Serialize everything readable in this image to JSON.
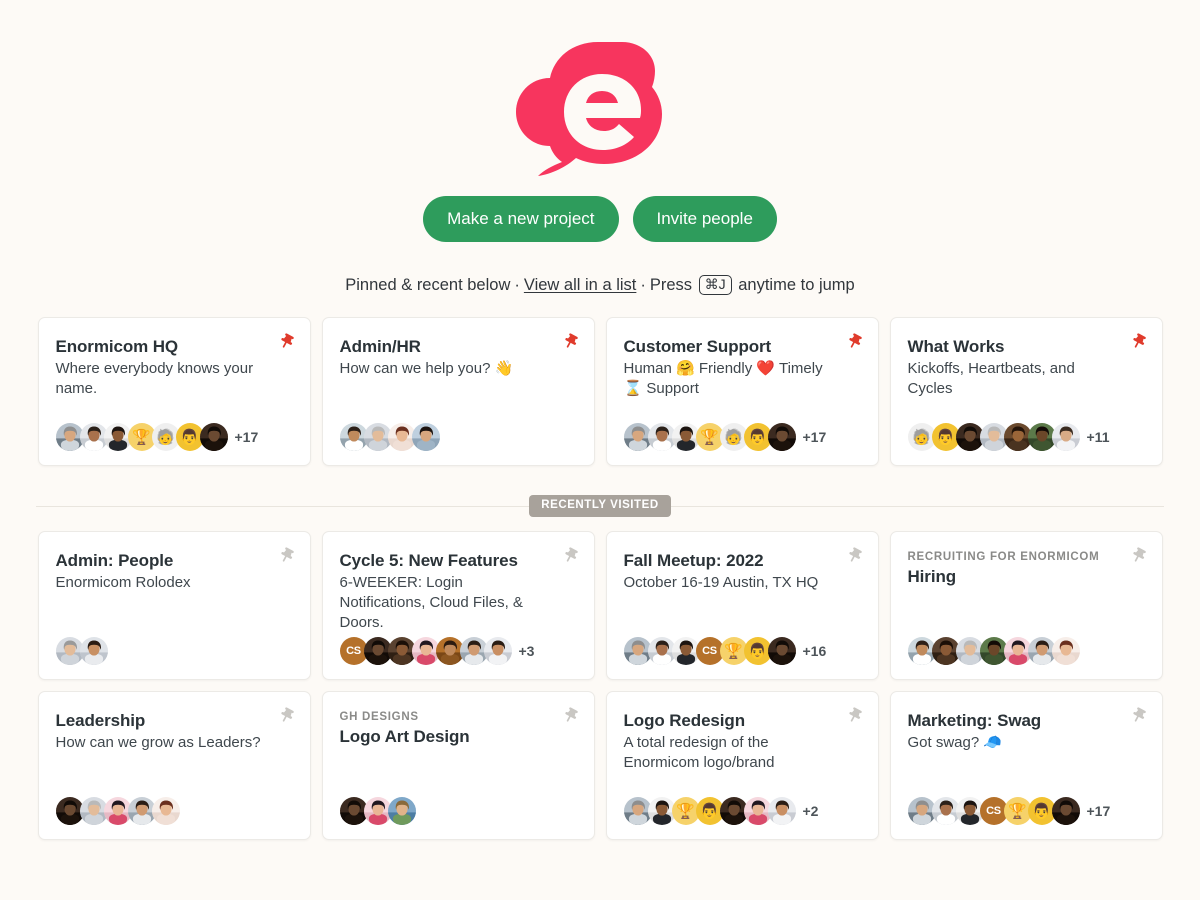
{
  "brand": {
    "logo_name": "basecamp-cloud-e-logo",
    "logo_color": "#f7355e",
    "button_color": "#2e9c5c"
  },
  "actions": {
    "new_project_label": "Make a new project",
    "invite_people_label": "Invite people"
  },
  "jumpline": {
    "prefix": "Pinned & recent below",
    "link_label": "View all in a list",
    "press_label": "Press",
    "shortcut": "⌘J",
    "suffix": "anytime to jump",
    "separator": "·"
  },
  "divider": {
    "label": "RECENTLY VISITED"
  },
  "pinned": [
    {
      "title": "Enormicom HQ",
      "eyebrow": "",
      "desc": "Where everybody knows your name.",
      "pinned": true,
      "more": "+17",
      "avatars": [
        {
          "type": "photo",
          "c1": "#b7c2cc",
          "c2": "#6f7d88",
          "skin": "#d7a77f",
          "hair": "#8e8e8e",
          "shirt": "#cfd6dc"
        },
        {
          "type": "photo",
          "c1": "#e3e6ea",
          "c2": "#c7ccd2",
          "skin": "#a9714c",
          "hair": "#2b2019",
          "shirt": "#ffffff"
        },
        {
          "type": "photo",
          "c1": "#f2f2f2",
          "c2": "#dedede",
          "skin": "#8a5a36",
          "hair": "#1c1410",
          "shirt": "#23262b"
        },
        {
          "type": "emoji",
          "glyph": "🏆",
          "bg": "#f6d26a"
        },
        {
          "type": "emoji",
          "glyph": "🧓",
          "bg": "#efefef"
        },
        {
          "type": "emoji",
          "glyph": "👨",
          "bg": "#f2c230"
        },
        {
          "type": "photo",
          "c1": "#3b2a20",
          "c2": "#120b07",
          "skin": "#6b4a32",
          "hair": "#110b07",
          "shirt": "#1c120b"
        }
      ]
    },
    {
      "title": "Admin/HR",
      "eyebrow": "",
      "desc": "How can we help you? 👋",
      "pinned": true,
      "more": "",
      "avatars": [
        {
          "type": "photo",
          "c1": "#cdd8de",
          "c2": "#94a3ad",
          "skin": "#c08a5c",
          "hair": "#2d2018",
          "shirt": "#ffffff"
        },
        {
          "type": "photo",
          "c1": "#d8dce2",
          "c2": "#b2b9c2",
          "skin": "#e3bc9a",
          "hair": "#b9b9b9",
          "shirt": "#cfd4da"
        },
        {
          "type": "photo",
          "c1": "#f7eee9",
          "c2": "#e9d8cf",
          "skin": "#e8b894",
          "hair": "#6b2f1e",
          "shirt": "#f0dfd6"
        },
        {
          "type": "photo",
          "c1": "#bfd0df",
          "c2": "#8fa5b8",
          "skin": "#d7a77f",
          "hair": "#1d1410",
          "shirt": "#9fb4c6"
        }
      ]
    },
    {
      "title": "Customer Support",
      "eyebrow": "",
      "desc": "Human 🤗 Friendly ❤️ Timely ⌛ Support",
      "pinned": true,
      "more": "+17",
      "avatars": [
        {
          "type": "photo",
          "c1": "#b7c2cc",
          "c2": "#6f7d88",
          "skin": "#d7a77f",
          "hair": "#8e8e8e",
          "shirt": "#cfd6dc"
        },
        {
          "type": "photo",
          "c1": "#e3e6ea",
          "c2": "#c7ccd2",
          "skin": "#a9714c",
          "hair": "#2b2019",
          "shirt": "#ffffff"
        },
        {
          "type": "photo",
          "c1": "#f2f2f2",
          "c2": "#dedede",
          "skin": "#8a5a36",
          "hair": "#1c1410",
          "shirt": "#23262b"
        },
        {
          "type": "emoji",
          "glyph": "🏆",
          "bg": "#f6d26a"
        },
        {
          "type": "emoji",
          "glyph": "🧓",
          "bg": "#efefef"
        },
        {
          "type": "emoji",
          "glyph": "👨",
          "bg": "#f2c230"
        },
        {
          "type": "photo",
          "c1": "#3b2a20",
          "c2": "#120b07",
          "skin": "#6b4a32",
          "hair": "#110b07",
          "shirt": "#1c120b"
        }
      ]
    },
    {
      "title": "What Works",
      "eyebrow": "",
      "desc": "Kickoffs, Heartbeats, and Cycles",
      "pinned": true,
      "more": "+11",
      "avatars": [
        {
          "type": "emoji",
          "glyph": "🧓",
          "bg": "#efefef"
        },
        {
          "type": "emoji",
          "glyph": "👨",
          "bg": "#f2c230"
        },
        {
          "type": "photo",
          "c1": "#3b2a20",
          "c2": "#120b07",
          "skin": "#6b4a32",
          "hair": "#110b07",
          "shirt": "#1c120b"
        },
        {
          "type": "photo",
          "c1": "#d8dce2",
          "c2": "#b2b9c2",
          "skin": "#e3bc9a",
          "hair": "#b9b9b9",
          "shirt": "#cfd4da"
        },
        {
          "type": "photo",
          "c1": "#6b4a2e",
          "c2": "#3a2616",
          "skin": "#9a6538",
          "hair": "#241409",
          "shirt": "#4a3320"
        },
        {
          "type": "photo",
          "c1": "#5c7a4a",
          "c2": "#33482a",
          "skin": "#6b4729",
          "hair": "#120b06",
          "shirt": "#3f5631"
        },
        {
          "type": "photo",
          "c1": "#e8eaee",
          "c2": "#c9ccd3",
          "skin": "#d8ab86",
          "hair": "#3a2b20",
          "shirt": "#f2f3f5"
        }
      ]
    }
  ],
  "recent_row1": [
    {
      "title": "Admin: People",
      "eyebrow": "",
      "desc": "Enormicom Rolodex",
      "pinned": false,
      "more": "",
      "avatars": [
        {
          "type": "photo",
          "c1": "#d8dce2",
          "c2": "#b2b9c2",
          "skin": "#e3bc9a",
          "hair": "#9a9a9a",
          "shirt": "#cfd4da"
        },
        {
          "type": "photo",
          "c1": "#dfe3e8",
          "c2": "#bfc5cd",
          "skin": "#c89063",
          "hair": "#2a1c13",
          "shirt": "#e9ebee"
        }
      ]
    },
    {
      "title": "Cycle 5: New Features",
      "eyebrow": "",
      "desc": "6-WEEKER: Login Notifications, Cloud Files, & Doors.",
      "pinned": false,
      "more": "+3",
      "avatars": [
        {
          "type": "initials",
          "text": "CS",
          "bg": "#b5712a"
        },
        {
          "type": "photo",
          "c1": "#3b2a20",
          "c2": "#120b07",
          "skin": "#6b4a32",
          "hair": "#110b07",
          "shirt": "#1c120b"
        },
        {
          "type": "photo",
          "c1": "#5a4230",
          "c2": "#2e1f13",
          "skin": "#8a5a36",
          "hair": "#1b0f07",
          "shirt": "#4d3522"
        },
        {
          "type": "photo",
          "c1": "#f6d7de",
          "c2": "#e6b9c4",
          "skin": "#e9b695",
          "hair": "#221820",
          "shirt": "#d94a6a"
        },
        {
          "type": "photo",
          "c1": "#b5712a",
          "c2": "#7a4716",
          "skin": "#c08a5c",
          "hair": "#2d1c10",
          "shirt": "#8c5620"
        },
        {
          "type": "photo",
          "c1": "#c8cfd6",
          "c2": "#9aa6b0",
          "skin": "#d09b72",
          "hair": "#2a1d15",
          "shirt": "#e6e9ec"
        },
        {
          "type": "photo",
          "c1": "#e8eaee",
          "c2": "#c9ccd3",
          "skin": "#c98f63",
          "hair": "#2b1d14",
          "shirt": "#f2f3f5"
        }
      ]
    },
    {
      "title": "Fall Meetup: 2022",
      "eyebrow": "",
      "desc": "October 16-19 Austin, TX HQ",
      "pinned": false,
      "more": "+16",
      "avatars": [
        {
          "type": "photo",
          "c1": "#b7c2cc",
          "c2": "#6f7d88",
          "skin": "#d7a77f",
          "hair": "#8e8e8e",
          "shirt": "#cfd6dc"
        },
        {
          "type": "photo",
          "c1": "#e3e6ea",
          "c2": "#c7ccd2",
          "skin": "#a9714c",
          "hair": "#2b2019",
          "shirt": "#ffffff"
        },
        {
          "type": "photo",
          "c1": "#f2f2f2",
          "c2": "#dedede",
          "skin": "#8a5a36",
          "hair": "#1c1410",
          "shirt": "#23262b"
        },
        {
          "type": "initials",
          "text": "CS",
          "bg": "#b5712a"
        },
        {
          "type": "emoji",
          "glyph": "🏆",
          "bg": "#f6d26a"
        },
        {
          "type": "emoji",
          "glyph": "👨",
          "bg": "#f2c230"
        },
        {
          "type": "photo",
          "c1": "#3b2a20",
          "c2": "#120b07",
          "skin": "#6b4a32",
          "hair": "#110b07",
          "shirt": "#1c120b"
        }
      ]
    },
    {
      "title": "Hiring",
      "eyebrow": "RECRUITING FOR ENORMICOM",
      "desc": "",
      "pinned": false,
      "more": "",
      "avatars": [
        {
          "type": "photo",
          "c1": "#cdd8de",
          "c2": "#94a3ad",
          "skin": "#c08a5c",
          "hair": "#2d2018",
          "shirt": "#ffffff"
        },
        {
          "type": "photo",
          "c1": "#5a4230",
          "c2": "#2e1f13",
          "skin": "#8a5a36",
          "hair": "#1b0f07",
          "shirt": "#4d3522"
        },
        {
          "type": "photo",
          "c1": "#d8dce2",
          "c2": "#b2b9c2",
          "skin": "#e3bc9a",
          "hair": "#b9b9b9",
          "shirt": "#cfd4da"
        },
        {
          "type": "photo",
          "c1": "#5c7a4a",
          "c2": "#33482a",
          "skin": "#6b4729",
          "hair": "#120b06",
          "shirt": "#3f5631"
        },
        {
          "type": "photo",
          "c1": "#f6d7de",
          "c2": "#e6b9c4",
          "skin": "#e9b695",
          "hair": "#221820",
          "shirt": "#d94a6a"
        },
        {
          "type": "photo",
          "c1": "#c8cfd6",
          "c2": "#9aa6b0",
          "skin": "#d09b72",
          "hair": "#2a1d15",
          "shirt": "#e6e9ec"
        },
        {
          "type": "photo",
          "c1": "#f7eee9",
          "c2": "#e9d8cf",
          "skin": "#e8b894",
          "hair": "#6b2f1e",
          "shirt": "#f0dfd6"
        }
      ]
    }
  ],
  "recent_row2": [
    {
      "title": "Leadership",
      "eyebrow": "",
      "desc": "How can we grow as Leaders?",
      "pinned": false,
      "more": "",
      "avatars": [
        {
          "type": "photo",
          "c1": "#3b2a20",
          "c2": "#120b07",
          "skin": "#6b4a32",
          "hair": "#110b07",
          "shirt": "#1c120b"
        },
        {
          "type": "photo",
          "c1": "#d8dce2",
          "c2": "#b2b9c2",
          "skin": "#e3bc9a",
          "hair": "#b9b9b9",
          "shirt": "#cfd4da"
        },
        {
          "type": "photo",
          "c1": "#f6d7de",
          "c2": "#e6b9c4",
          "skin": "#e9b695",
          "hair": "#221820",
          "shirt": "#d94a6a"
        },
        {
          "type": "photo",
          "c1": "#c8cfd6",
          "c2": "#9aa6b0",
          "skin": "#d09b72",
          "hair": "#2a1d15",
          "shirt": "#e6e9ec"
        },
        {
          "type": "photo",
          "c1": "#f7eee9",
          "c2": "#e9d8cf",
          "skin": "#e8b894",
          "hair": "#6b2f1e",
          "shirt": "#f0dfd6"
        }
      ]
    },
    {
      "title": "Logo Art Design",
      "eyebrow": "GH DESIGNS",
      "desc": "",
      "pinned": false,
      "more": "",
      "avatars": [
        {
          "type": "photo",
          "c1": "#3b2a20",
          "c2": "#120b07",
          "skin": "#6b4a32",
          "hair": "#110b07",
          "shirt": "#1c120b"
        },
        {
          "type": "photo",
          "c1": "#f6d7de",
          "c2": "#e6b9c4",
          "skin": "#e9b695",
          "hair": "#221820",
          "shirt": "#d94a6a"
        },
        {
          "type": "photo",
          "c1": "#7fa8c9",
          "c2": "#4d7ea4",
          "skin": "#e0b38a",
          "hair": "#8a6a3a",
          "shirt": "#6f9a5c"
        }
      ]
    },
    {
      "title": "Logo Redesign",
      "eyebrow": "",
      "desc": "A total redesign of the Enormicom logo/brand",
      "pinned": false,
      "more": "+2",
      "avatars": [
        {
          "type": "photo",
          "c1": "#b7c2cc",
          "c2": "#6f7d88",
          "skin": "#d7a77f",
          "hair": "#8e8e8e",
          "shirt": "#cfd6dc"
        },
        {
          "type": "photo",
          "c1": "#f2f2f2",
          "c2": "#dedede",
          "skin": "#8a5a36",
          "hair": "#1c1410",
          "shirt": "#23262b"
        },
        {
          "type": "emoji",
          "glyph": "🏆",
          "bg": "#f6d26a"
        },
        {
          "type": "emoji",
          "glyph": "👨",
          "bg": "#f2c230"
        },
        {
          "type": "photo",
          "c1": "#3b2a20",
          "c2": "#120b07",
          "skin": "#6b4a32",
          "hair": "#110b07",
          "shirt": "#1c120b"
        },
        {
          "type": "photo",
          "c1": "#f6d7de",
          "c2": "#e6b9c4",
          "skin": "#e9b695",
          "hair": "#221820",
          "shirt": "#d94a6a"
        },
        {
          "type": "photo",
          "c1": "#e8eaee",
          "c2": "#c9ccd3",
          "skin": "#c98f63",
          "hair": "#2b1d14",
          "shirt": "#f2f3f5"
        }
      ]
    },
    {
      "title": "Marketing: Swag",
      "eyebrow": "",
      "desc": "Got swag? 🧢",
      "pinned": false,
      "more": "+17",
      "avatars": [
        {
          "type": "photo",
          "c1": "#b7c2cc",
          "c2": "#6f7d88",
          "skin": "#d7a77f",
          "hair": "#8e8e8e",
          "shirt": "#cfd6dc"
        },
        {
          "type": "photo",
          "c1": "#e3e6ea",
          "c2": "#c7ccd2",
          "skin": "#a9714c",
          "hair": "#2b2019",
          "shirt": "#ffffff"
        },
        {
          "type": "photo",
          "c1": "#f2f2f2",
          "c2": "#dedede",
          "skin": "#8a5a36",
          "hair": "#1c1410",
          "shirt": "#23262b"
        },
        {
          "type": "initials",
          "text": "CS",
          "bg": "#b5712a"
        },
        {
          "type": "emoji",
          "glyph": "🏆",
          "bg": "#f6d26a"
        },
        {
          "type": "emoji",
          "glyph": "👨",
          "bg": "#f2c230"
        },
        {
          "type": "photo",
          "c1": "#3b2a20",
          "c2": "#120b07",
          "skin": "#6b4a32",
          "hair": "#110b07",
          "shirt": "#1c120b"
        }
      ]
    }
  ]
}
